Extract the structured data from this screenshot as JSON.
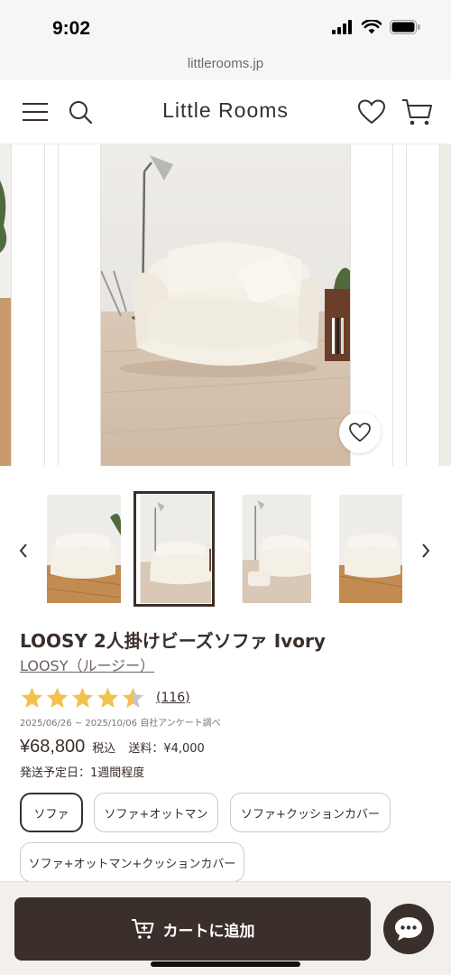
{
  "status_bar": {
    "time": "9:02"
  },
  "browser": {
    "url": "littlerooms.jp"
  },
  "header": {
    "brand": "Little Rooms",
    "menu_icon": "menu-icon",
    "search_icon": "search-icon",
    "favorite_icon": "heart-icon",
    "cart_icon": "cart-icon"
  },
  "product": {
    "title": "LOOSY 2人掛けビーズソファ Ivory",
    "brand_link": "LOOSY（ルージー）",
    "rating": 4.5,
    "review_count": "(116)",
    "survey_note": "2025/06/26 ~ 2025/10/06 自社アンケート調べ",
    "price": "¥68,800",
    "tax_label": "税込",
    "shipping": "送料：¥4,000",
    "delivery": "発送予定日：1週間程度",
    "selected_thumbnail": 2
  },
  "options": [
    {
      "label": "ソファ",
      "selected": true
    },
    {
      "label": "ソファ+オットマン",
      "selected": false
    },
    {
      "label": "ソファ+クッションカバー",
      "selected": false
    },
    {
      "label": "ソファ+オットマン+クッションカバー",
      "selected": false
    }
  ],
  "cart_button": {
    "label": "カートに追加",
    "icon": "cart-plus-icon"
  },
  "chat_button": {
    "icon": "chat-icon"
  },
  "colors": {
    "primary": "#3b2f2c",
    "star": "#f2c14e",
    "text": "#3a2f2a"
  }
}
